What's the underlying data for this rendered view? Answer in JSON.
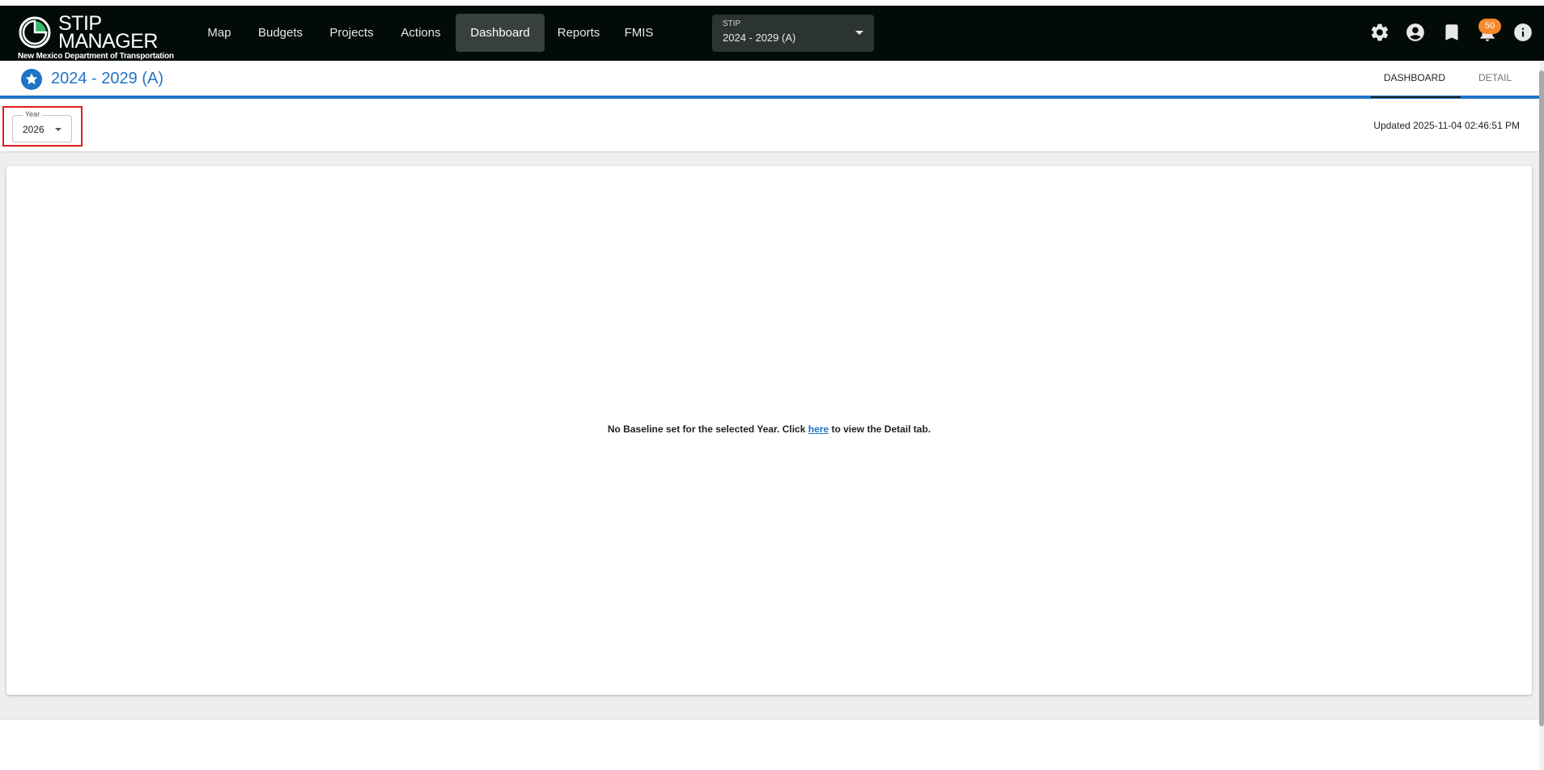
{
  "app": {
    "logo_line1": "STIP",
    "logo_line2": "MANAGER",
    "logo_subtitle": "New Mexico Department of Transportation"
  },
  "nav": {
    "items": [
      {
        "label": "Map"
      },
      {
        "label": "Budgets"
      },
      {
        "label": "Projects"
      },
      {
        "label": "Actions"
      },
      {
        "label": "Dashboard",
        "active": true
      },
      {
        "label": "Reports"
      },
      {
        "label": "FMIS"
      }
    ],
    "stip_select": {
      "label": "STIP",
      "value": "2024 - 2029 (A)"
    },
    "icons": [
      "gear-icon",
      "account-circle-icon",
      "bookmark-icon",
      "bell-icon",
      "info-icon"
    ],
    "notification_count": "50"
  },
  "page": {
    "title": "2024 - 2029 (A)",
    "tabs": [
      {
        "label": "DASHBOARD",
        "active": true
      },
      {
        "label": "DETAIL"
      }
    ]
  },
  "filters": {
    "year_label": "Year",
    "year_value": "2026",
    "updated_text": "Updated 2025-11-04 02:46:51 PM"
  },
  "content": {
    "message_before": "No Baseline set for the selected Year. Click ",
    "message_link": "here",
    "message_after": " to view the Detail tab."
  },
  "colors": {
    "navbar_bg": "#030b07",
    "accent": "#1f74c7",
    "badge": "#f5892b",
    "highlight": "#e21b1b"
  }
}
